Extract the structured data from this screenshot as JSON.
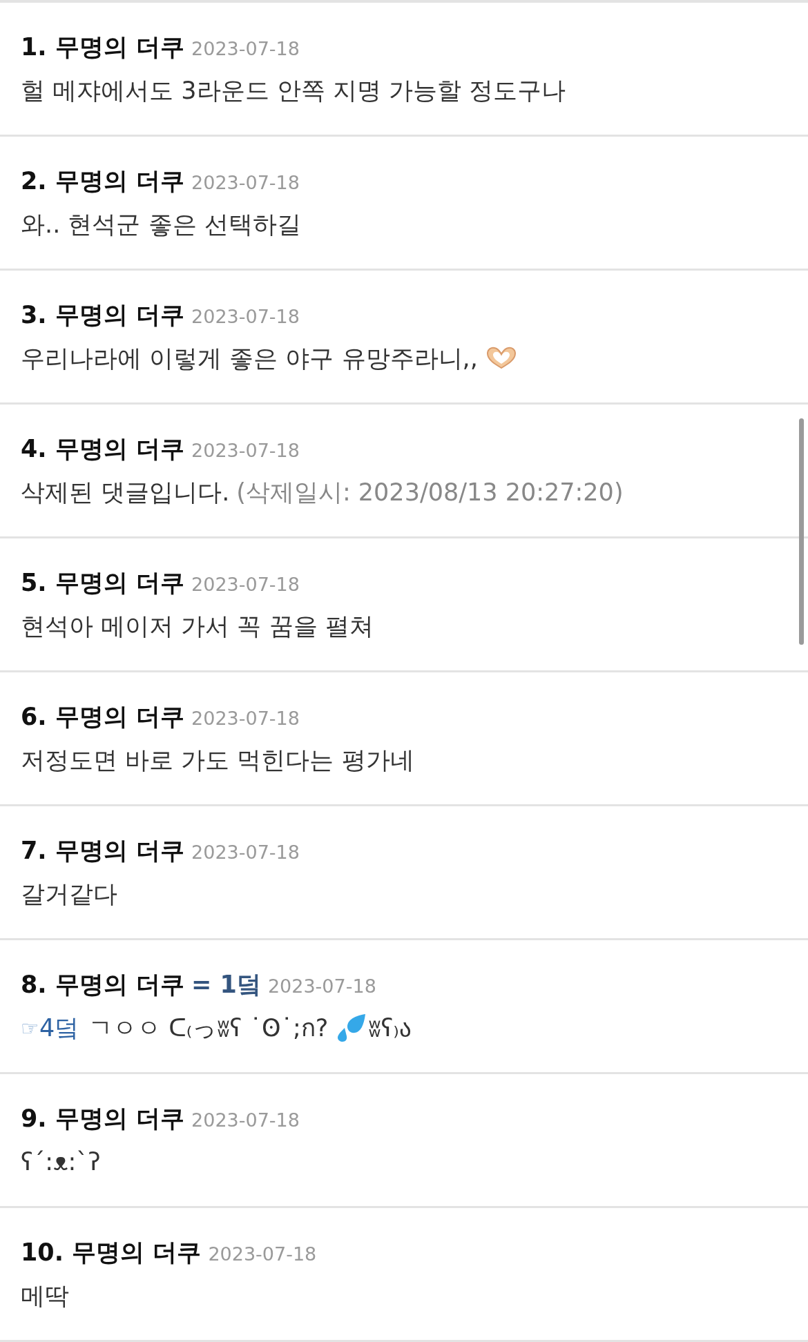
{
  "comments": [
    {
      "title": "1. 무명의 더쿠",
      "date": "2023-07-18",
      "body": [
        {
          "kind": "text",
          "text": "헐 메쟈에서도 3라운드 안쪽 지명 가능할 정도구나"
        }
      ]
    },
    {
      "title": "2. 무명의 더쿠",
      "date": "2023-07-18",
      "body": [
        {
          "kind": "text",
          "text": "와.. 현석군 좋은 선택하길"
        }
      ]
    },
    {
      "title": "3. 무명의 더쿠",
      "date": "2023-07-18",
      "body": [
        {
          "kind": "text",
          "text": "우리나라에 이렇게 좋은 야구 유망주라니,,"
        },
        {
          "kind": "hearthands"
        }
      ]
    },
    {
      "title": "4. 무명의 더쿠",
      "date": "2023-07-18",
      "body": [
        {
          "kind": "text",
          "text": "삭제된 댓글입니다."
        },
        {
          "kind": "muted",
          "text": "(삭제일시: 2023/08/13 20:27:20)"
        }
      ]
    },
    {
      "title": "5. 무명의 더쿠",
      "date": "2023-07-18",
      "body": [
        {
          "kind": "text",
          "text": "현석아 메이저 가서 꼭 꿈을 펼쳐"
        }
      ]
    },
    {
      "title": "6. 무명의 더쿠",
      "date": "2023-07-18",
      "body": [
        {
          "kind": "text",
          "text": "저정도면 바로 가도 먹힌다는 평가네"
        }
      ]
    },
    {
      "title": "7. 무명의 더쿠",
      "date": "2023-07-18",
      "body": [
        {
          "kind": "text",
          "text": "갈거같다"
        }
      ]
    },
    {
      "title": "8. 무명의 더쿠",
      "badge": "= 1덬",
      "date": "2023-07-18",
      "body": [
        {
          "kind": "pointer",
          "text": "☞"
        },
        {
          "kind": "link",
          "text": "4덬"
        },
        {
          "kind": "text",
          "text": "ㄱㅇㅇ ᑕ₍っʬʕ ˙ʘ˙;ก?"
        },
        {
          "kind": "droplets"
        },
        {
          "kind": "text",
          "text": "ʬʕ₎ა"
        }
      ]
    },
    {
      "title": "9. 무명의 더쿠",
      "date": "2023-07-18",
      "body": [
        {
          "kind": "text",
          "text": "ʕ´:ᴥ:`ʔ"
        }
      ]
    },
    {
      "title": "10. 무명의 더쿠",
      "date": "2023-07-18",
      "body": [
        {
          "kind": "text",
          "text": "메딱"
        }
      ]
    }
  ]
}
